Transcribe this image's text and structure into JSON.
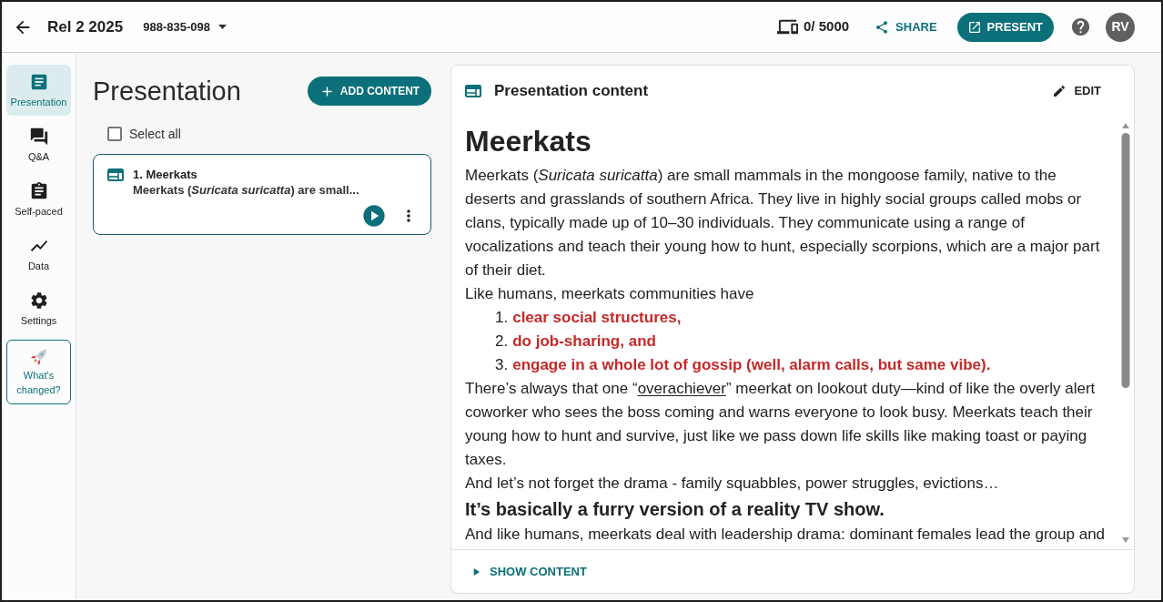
{
  "header": {
    "title": "Rel 2 2025",
    "code": "988-835-098",
    "device_count": "0/ 5000",
    "share": "SHARE",
    "present": "PRESENT",
    "avatar": "RV"
  },
  "sidebar": {
    "items": [
      {
        "label": "Presentation",
        "selected": true
      },
      {
        "label": "Q&A",
        "selected": false
      },
      {
        "label": "Self-paced",
        "selected": false
      },
      {
        "label": "Data",
        "selected": false
      },
      {
        "label": "Settings",
        "selected": false
      }
    ],
    "whats_changed": "What's changed?"
  },
  "list_panel": {
    "title": "Presentation",
    "add_button": "ADD CONTENT",
    "select_all": {
      "label": "Select all",
      "checked": false
    },
    "items": [
      {
        "title": "1. Meerkats",
        "summary": "Meerkats (*Suricata suricatta*) are small..."
      }
    ]
  },
  "content_panel": {
    "title": "Presentation content",
    "edit": "EDIT",
    "blocks": [
      {
        "kind": "heading",
        "text": "Meerkats"
      },
      {
        "kind": "paragraph",
        "runs": [
          {
            "text": "Meerkats (*Suricata suricatta*) are small mammals in the mongoose family, native to the deserts and grasslands of southern Africa. They live in highly social groups called mobs or clans, typically made up of 10–30 individuals. They communicate using a range of vocalizations and teach their young how to hunt, especially scorpions, which are a major part of their diet.",
            "underline": false
          }
        ]
      },
      {
        "kind": "paragraph",
        "runs": [
          {
            "text": "Like humans, meerkats communities have",
            "underline": false
          }
        ]
      },
      {
        "kind": "list",
        "items": [
          {
            "number": "1.",
            "text": "clear social structures,"
          },
          {
            "number": "2.",
            "text": "do job-sharing, and"
          },
          {
            "number": "3.",
            "text": "engage in a whole lot of gossip (well, alarm calls, but same vibe)."
          }
        ]
      },
      {
        "kind": "paragraph",
        "runs": [
          {
            "text": "There’s always that one “",
            "underline": false
          },
          {
            "text": "overachiever",
            "underline": true
          },
          {
            "text": "” meerkat on lookout duty—kind of like the overly alert coworker who sees the boss coming and warns everyone to look busy. Meerkats teach their young how to hunt and survive, just like we pass down life skills like making toast or paying taxes.",
            "underline": false
          }
        ]
      },
      {
        "kind": "paragraph",
        "runs": [
          {
            "text": "And let’s not forget the drama - family squabbles, power struggles, evictions…",
            "underline": false
          }
        ]
      },
      {
        "kind": "subheading",
        "text": "It’s basically a furry version of a reality TV show."
      },
      {
        "kind": "paragraph",
        "runs": [
          {
            "text": "And like humans, meerkats deal with leadership drama: dominant females lead the group and",
            "underline": false
          }
        ]
      }
    ],
    "show_content": "SHOW CONTENT"
  }
}
